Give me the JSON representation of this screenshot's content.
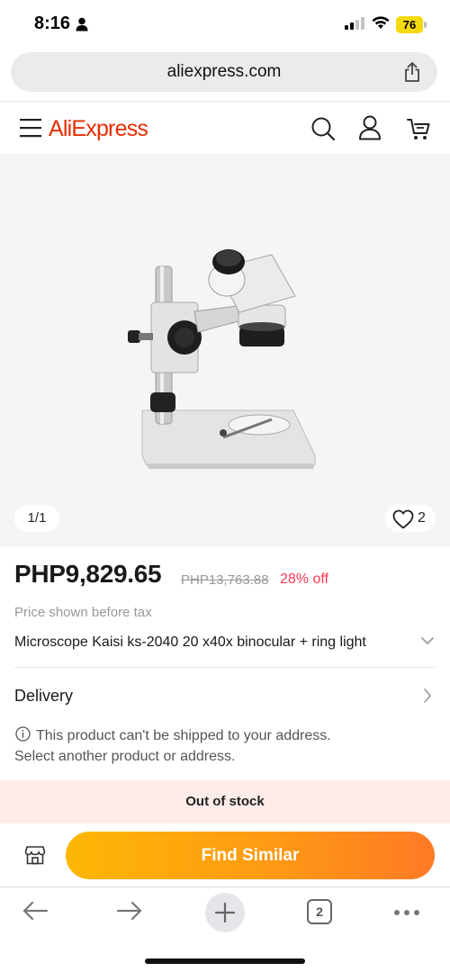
{
  "status_bar": {
    "time": "8:16",
    "battery": "76",
    "icons": [
      "person-icon",
      "signal-icon",
      "wifi-icon",
      "battery-icon"
    ]
  },
  "browser": {
    "url": "aliexpress.com",
    "tab_count": "2",
    "icons": [
      "share-icon",
      "back-icon",
      "forward-icon",
      "plus-icon",
      "tabs-icon",
      "more-icon"
    ]
  },
  "header": {
    "logo": "AliExpress",
    "icons": [
      "menu-icon",
      "search-icon",
      "user-icon",
      "cart-icon"
    ]
  },
  "gallery": {
    "counter": "1/1",
    "wishlist_count": "2"
  },
  "product": {
    "price": "PHP9,829.65",
    "original_price": "PHP13,763.88",
    "discount": "28% off",
    "tax_note": "Price shown before tax",
    "variant": "Microscope Kaisi ks-2040 20 x40x binocular + ring light"
  },
  "delivery": {
    "title": "Delivery",
    "message_line1": "This product can't be shipped to your address.",
    "message_line2": "Select another product or address."
  },
  "stock": {
    "status": "Out of stock"
  },
  "actions": {
    "find_similar": "Find Similar"
  },
  "colors": {
    "brand": "#e62e04",
    "discount": "#fd384f",
    "button_start": "#fdb705",
    "button_end": "#ff7a25",
    "oos_background": "#fdece7"
  }
}
